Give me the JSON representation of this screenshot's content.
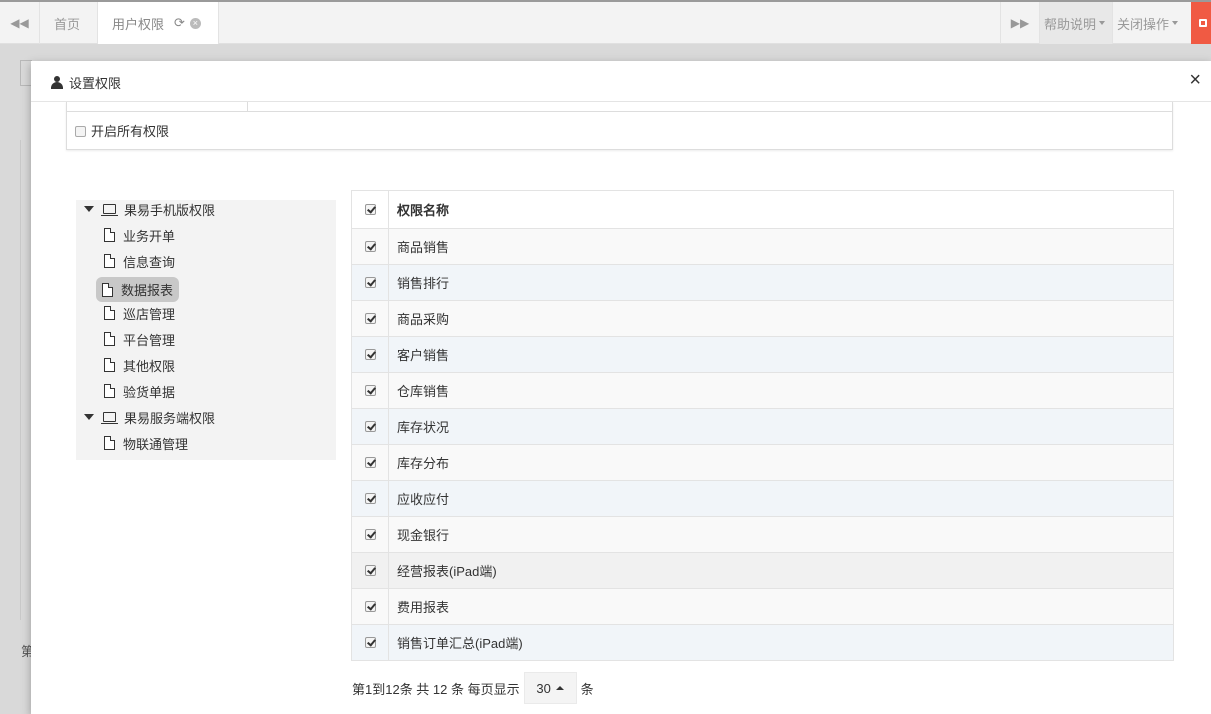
{
  "topbar": {
    "tabs": [
      {
        "label": "首页"
      },
      {
        "label": "用户权限"
      }
    ],
    "help_label": "帮助说明",
    "close_ops_label": "关闭操作"
  },
  "background": {
    "footer_fragment": "第"
  },
  "modal": {
    "title": "设置权限",
    "close_symbol": "×",
    "enable_all_label": "开启所有权限"
  },
  "tree": {
    "groups": [
      {
        "label": "果易手机版权限",
        "children": [
          "业务开单",
          "信息查询",
          "数据报表",
          "巡店管理",
          "平台管理",
          "其他权限",
          "验货单据"
        ]
      },
      {
        "label": "果易服务端权限",
        "children": [
          "物联通管理"
        ]
      }
    ],
    "selected": "数据报表"
  },
  "table": {
    "header": "权限名称",
    "rows": [
      {
        "name": "商品销售",
        "checked": true
      },
      {
        "name": "销售排行",
        "checked": true
      },
      {
        "name": "商品采购",
        "checked": true
      },
      {
        "name": "客户销售",
        "checked": true
      },
      {
        "name": "仓库销售",
        "checked": true
      },
      {
        "name": "库存状况",
        "checked": true
      },
      {
        "name": "库存分布",
        "checked": true
      },
      {
        "name": "应收应付",
        "checked": true
      },
      {
        "name": "现金银行",
        "checked": true
      },
      {
        "name": "经营报表(iPad端)",
        "checked": true
      },
      {
        "name": "费用报表",
        "checked": true
      },
      {
        "name": "销售订单汇总(iPad端)",
        "checked": true
      }
    ]
  },
  "pager": {
    "summary": "第1到12条 共 12 条 每页显示",
    "page_size": "30",
    "unit": "条"
  },
  "colors": {
    "exit_button": "#f05a43",
    "row_alt": "#f1f5f9"
  }
}
